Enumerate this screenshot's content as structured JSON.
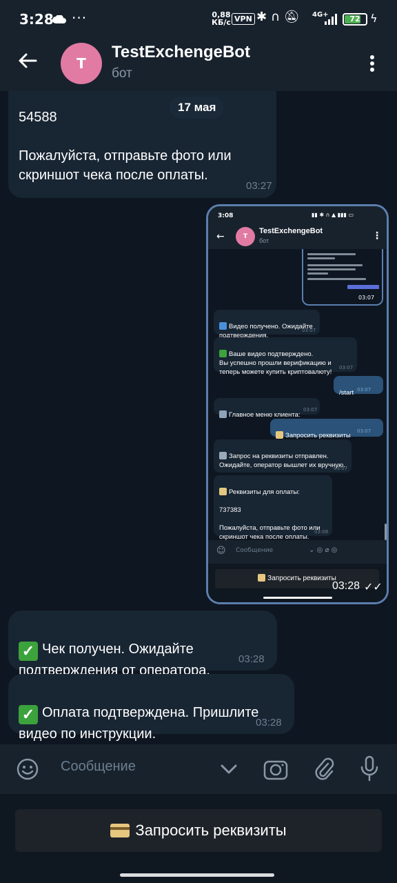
{
  "status_bar": {
    "time": "3:28",
    "dots": "···",
    "speed_value": "0,88",
    "speed_unit": "КБ/с",
    "vpn": "VPN",
    "network": "4G+",
    "battery": "72"
  },
  "header": {
    "avatar_letter": "T",
    "title": "TestExchengeBot",
    "subtitle": "бот"
  },
  "date_divider": "17 мая",
  "messages": [
    {
      "text": "54588\n\nПожалуйста, отправьте фото или скриншот чека после оплаты.",
      "time": "03:27"
    },
    {
      "text": "Чек получен. Ожидайте подтверждения от оператора.",
      "time": "03:28"
    },
    {
      "text": "Оплата подтверждена. Пришлите видео по инструкции.",
      "time": "03:28"
    }
  ],
  "screenshot": {
    "time": "3:08",
    "title": "TestExchengeBot",
    "subtitle": "бот",
    "avatar_letter": "T",
    "nested_time": "03:07",
    "messages": [
      {
        "text": "Видео получено. Ожидайте подтверждения.",
        "time": "03:07"
      },
      {
        "text": "Ваше видео подтверждено.\nВы успешно прошли верификацию и теперь можете купить криптовалюту!",
        "time": "03:07"
      },
      {
        "text": "/start",
        "time": "03:07"
      },
      {
        "text": "Главное меню клиента:",
        "time": "03:07"
      },
      {
        "text": "Запросить реквизиты",
        "time": "03:07"
      },
      {
        "text": "Запрос на реквизиты отправлен. Ожидайте, оператор вышлет их вручную.",
        "time": "03:07"
      },
      {
        "text": "Реквизиты для оплаты:\n\n737383\n\nПожалуйста, отправьте фото или скриншот чека после оплаты.",
        "time": "03:08"
      }
    ],
    "input_placeholder": "Сообщение",
    "keyboard_button": "Запросить реквизиты",
    "overlay_time": "03:28"
  },
  "input": {
    "placeholder": "Сообщение"
  },
  "keyboard": {
    "button_label": "Запросить реквизиты"
  },
  "colors": {
    "background": "#0e1621",
    "bubble_in": "#182533",
    "bubble_out": "#2b5278",
    "accent": "#5b7fae",
    "avatar": "#e17ba4",
    "check_green": "#3ca23c"
  }
}
